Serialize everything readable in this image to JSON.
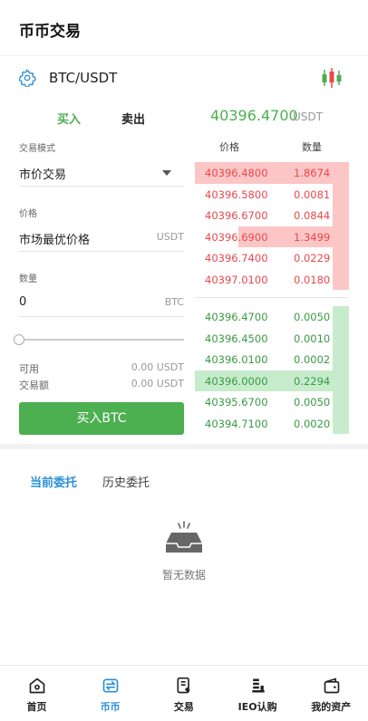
{
  "header": {
    "title": "币币交易"
  },
  "pairbar": {
    "pair": "BTC/USDT"
  },
  "trade_tabs": {
    "buy": "买入",
    "sell": "卖出"
  },
  "last_price": {
    "value": "40396.4700",
    "unit": "USDT"
  },
  "form": {
    "mode_label": "交易模式",
    "mode_value": "市价交易",
    "price_label": "价格",
    "price_value": "市场最优价格",
    "price_unit": "USDT",
    "amount_label": "数量",
    "amount_value": "0",
    "amount_unit": "BTC",
    "slider_fraction": 0,
    "available_label": "可用",
    "available_value": "0.00 USDT",
    "volume_label": "交易额",
    "volume_value": "0.00 USDT",
    "buy_button": "买入BTC"
  },
  "orderbook": {
    "price_header": "价格",
    "qty_header": "数量",
    "asks": [
      {
        "price": "40396.4800",
        "qty": "1.8674",
        "depth": 1.0
      },
      {
        "price": "40396.5800",
        "qty": "0.0081",
        "depth": 0.1
      },
      {
        "price": "40396.6700",
        "qty": "0.0844",
        "depth": 0.1
      },
      {
        "price": "40396.6900",
        "qty": "1.3499",
        "depth": 0.72
      },
      {
        "price": "40396.7400",
        "qty": "0.0229",
        "depth": 0.1
      },
      {
        "price": "40397.0100",
        "qty": "0.0180",
        "depth": 0.1
      }
    ],
    "bids": [
      {
        "price": "40396.4700",
        "qty": "0.0050",
        "depth": 0.1
      },
      {
        "price": "40396.4500",
        "qty": "0.0010",
        "depth": 0.1
      },
      {
        "price": "40396.0100",
        "qty": "0.0002",
        "depth": 0.1
      },
      {
        "price": "40396.0000",
        "qty": "0.2294",
        "depth": 1.0
      },
      {
        "price": "40395.6700",
        "qty": "0.0050",
        "depth": 0.1
      },
      {
        "price": "40394.7100",
        "qty": "0.0020",
        "depth": 0.1
      }
    ]
  },
  "orders": {
    "tab_current": "当前委托",
    "tab_history": "历史委托",
    "empty_text": "暂无数据"
  },
  "nav": {
    "items": [
      {
        "label": "首页",
        "icon": "home-icon"
      },
      {
        "label": "币币",
        "icon": "exchange-icon"
      },
      {
        "label": "交易",
        "icon": "trade-doc-icon"
      },
      {
        "label": "IEO认购",
        "icon": "ieo-icon"
      },
      {
        "label": "我的资产",
        "icon": "wallet-icon"
      }
    ],
    "active_index": 1
  },
  "colors": {
    "buy": "#4caf50",
    "sell": "#e8494e",
    "accent": "#2a8fd8"
  }
}
